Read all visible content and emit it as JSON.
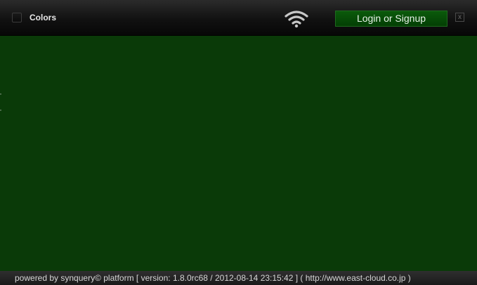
{
  "header": {
    "title": "Colors",
    "login_label": "Login or Signup",
    "close_label": "x",
    "icons": [
      "menu-toggle-icon",
      "wifi-icon"
    ]
  },
  "footer": {
    "text": "powered by synquery© platform [ version: 1.8.0rc68 / 2012-08-14 23:15:42 ] ( http://www.east-cloud.co.jp )"
  },
  "colors": {
    "background": "#0a3a08",
    "topbar": "#111111",
    "login_button": "#064a06",
    "footer": "#242424"
  }
}
